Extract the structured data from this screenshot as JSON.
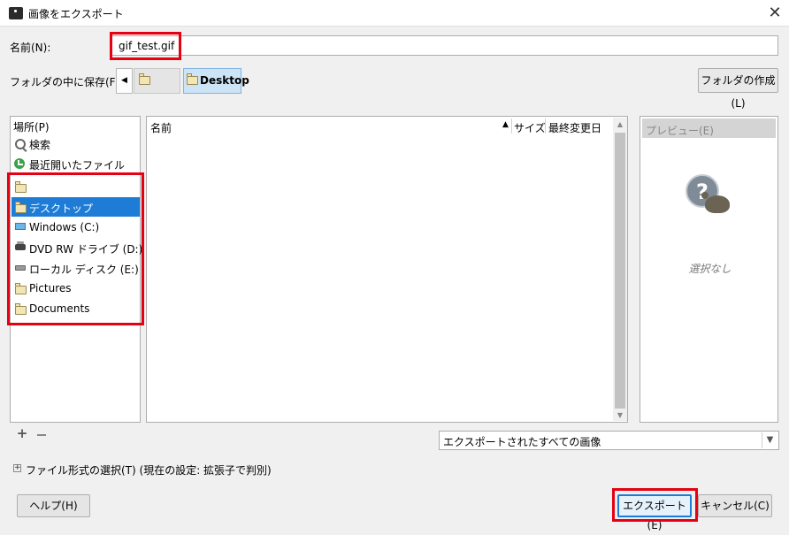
{
  "window": {
    "title": "画像をエクスポート",
    "close_glyph": "✕"
  },
  "name_row": {
    "label": "名前(N):",
    "value": "gif_test.gif"
  },
  "folder_row": {
    "label": "フォルダの中に保存(F):",
    "back_glyph": "◀",
    "crumbs": [
      "",
      "Desktop"
    ],
    "create_folder_label": "フォルダの作成(L)"
  },
  "places": {
    "header": "場所(P)",
    "items": [
      {
        "label": "検索",
        "icon": "search-icon"
      },
      {
        "label": "最近開いたファイル",
        "icon": "recent-icon"
      },
      {
        "label": "",
        "icon": "folder-icon"
      },
      {
        "label": "デスクトップ",
        "icon": "folder-icon",
        "selected": true
      },
      {
        "label": "Windows (C:)",
        "icon": "windows-drive-icon"
      },
      {
        "label": "DVD RW ドライブ (D:)",
        "icon": "dvd-drive-icon"
      },
      {
        "label": "ローカル ディスク (E:)",
        "icon": "disk-icon"
      },
      {
        "label": "Pictures",
        "icon": "folder-icon"
      },
      {
        "label": "Documents",
        "icon": "folder-icon"
      }
    ],
    "add_glyph": "+"
  },
  "file_list": {
    "columns": {
      "name": "名前",
      "size": "サイズ",
      "modified": "最終変更日"
    },
    "sort_glyph": "▲",
    "scroll_up_glyph": "▲",
    "scroll_down_glyph": "▼"
  },
  "preview": {
    "header": "プレビュー(E)",
    "empty_text": "選択なし",
    "icon_glyph": "?"
  },
  "file_type_filter": {
    "value": "エクスポートされたすべての画像",
    "arrow_glyph": "▼"
  },
  "file_type_expander": {
    "glyph": "+",
    "label": "ファイル形式の選択(T) (現在の設定: 拡張子で判別)"
  },
  "buttons": {
    "help": "ヘルプ(H)",
    "export": "エクスポート(E)",
    "cancel": "キャンセル(C)"
  },
  "colors": {
    "selection": "#1e7cd7",
    "highlight_box": "#e60012",
    "accent_focus": "#1e7cd7"
  }
}
